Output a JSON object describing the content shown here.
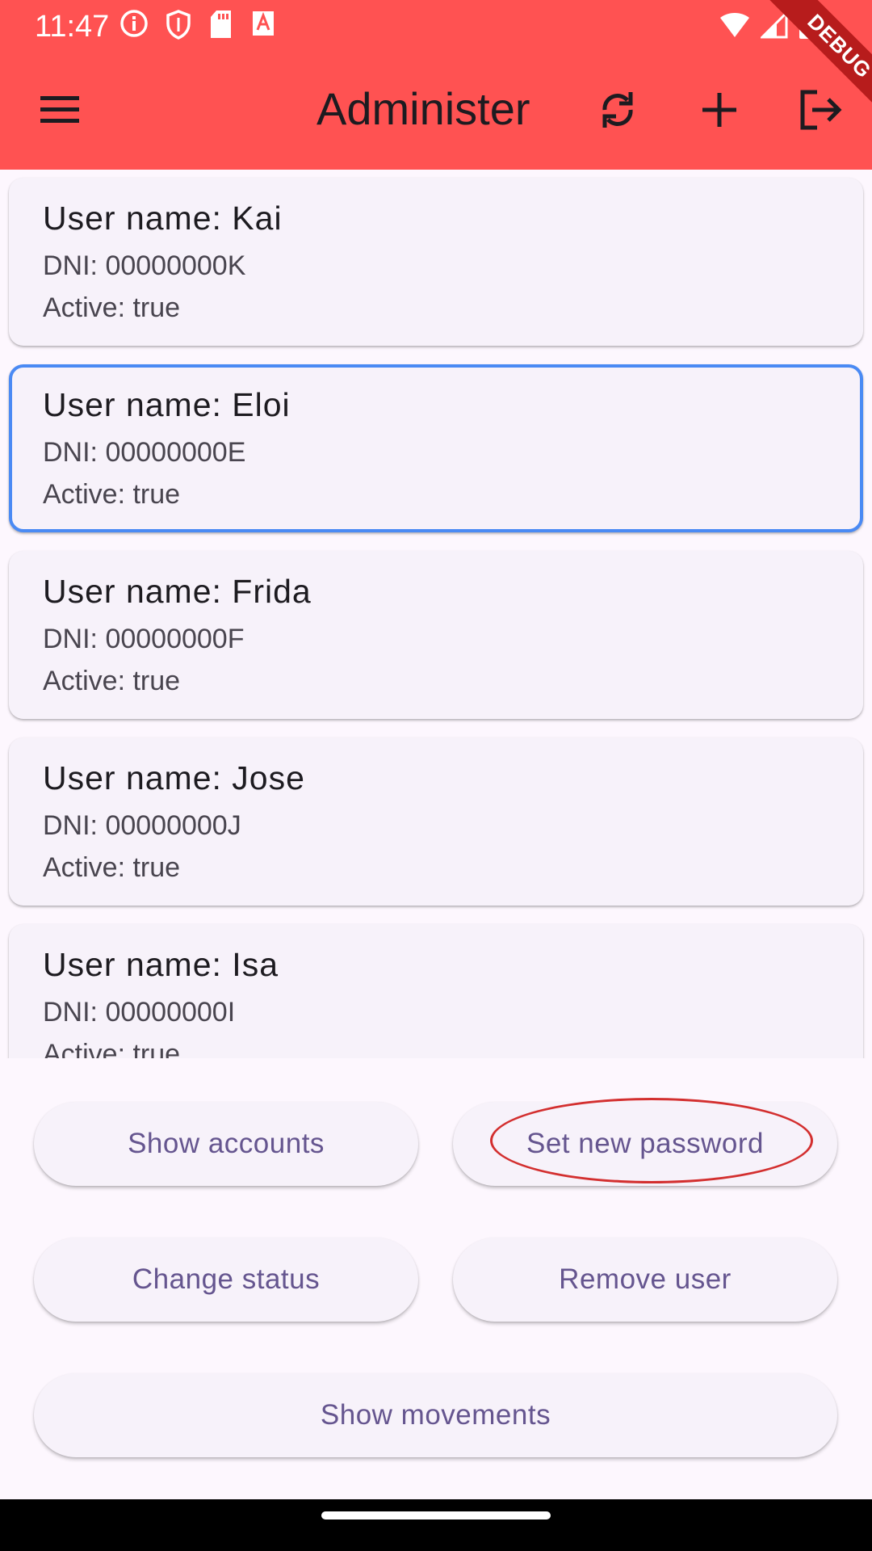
{
  "status_bar": {
    "time": "11:47",
    "left_icons": [
      "info-icon",
      "shield-icon",
      "sd-card-icon",
      "text-a-icon"
    ],
    "right_icons": [
      "wifi-icon",
      "signal-icon",
      "battery-icon"
    ],
    "debug_banner": "DEBUG"
  },
  "appbar": {
    "title": "Administer",
    "menu_icon": "hamburger-menu-icon",
    "actions": [
      "refresh-icon",
      "add-icon",
      "logout-icon"
    ],
    "background": "#FF5252"
  },
  "users": [
    {
      "name": "User name: Kai",
      "dni": "DNI: 00000000K",
      "active": "Active: true",
      "selected": false
    },
    {
      "name": "User name: Eloi",
      "dni": "DNI: 00000000E",
      "active": "Active: true",
      "selected": true
    },
    {
      "name": "User name: Frida",
      "dni": "DNI: 00000000F",
      "active": "Active: true",
      "selected": false
    },
    {
      "name": "User name: Jose",
      "dni": "DNI: 00000000J",
      "active": "Active: true",
      "selected": false
    },
    {
      "name": "User name: Isa",
      "dni": "DNI: 00000000I",
      "active": "Active: true",
      "selected": false
    }
  ],
  "actions": {
    "show_accounts": "Show accounts",
    "set_new_password": "Set new password",
    "change_status": "Change status",
    "remove_user": "Remove user",
    "show_movements": "Show movements"
  },
  "colors": {
    "accent": "#65558F",
    "selected_border": "#4A8AF4",
    "highlight": "#D32F2F"
  }
}
